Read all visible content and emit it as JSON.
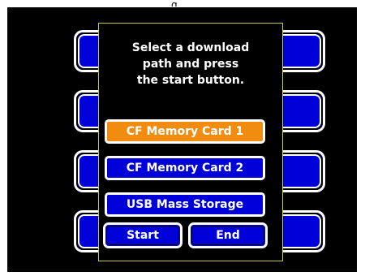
{
  "top_fragment": "g",
  "colors": {
    "selected": "#f08c10",
    "unselected": "#0000d8",
    "dialog_border": "#c8c840",
    "screen_bg": "#000000"
  },
  "dialog": {
    "message_lines": [
      "Select a download",
      "path and press",
      "the start button."
    ],
    "options": [
      {
        "label": "CF Memory Card 1",
        "selected": true
      },
      {
        "label": "CF Memory Card 2",
        "selected": false
      },
      {
        "label": "USB Mass Storage",
        "selected": false
      }
    ],
    "start_label": "Start",
    "end_label": "End"
  }
}
